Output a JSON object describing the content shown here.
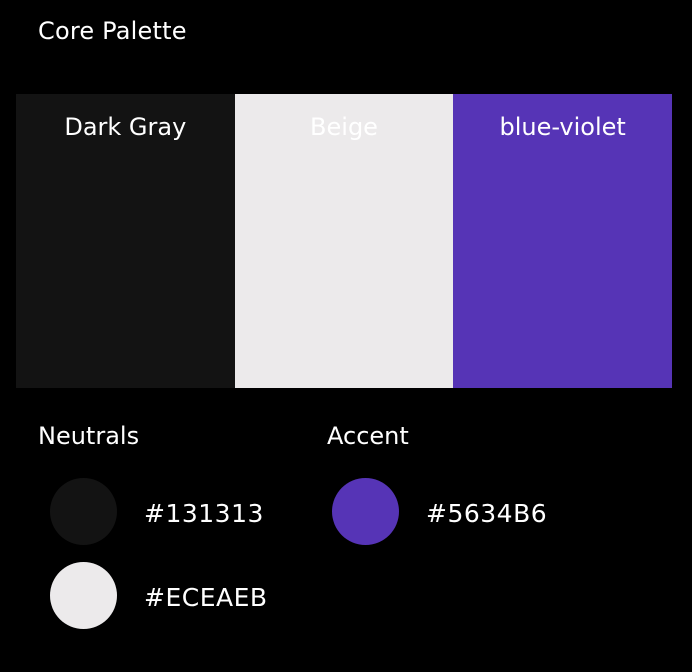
{
  "title": "Core Palette",
  "palette": [
    {
      "name": "Dark Gray",
      "color": "#131313"
    },
    {
      "name": "Beige",
      "color": "#ECEAEB"
    },
    {
      "name": "blue-violet",
      "color": "#5634B6"
    }
  ],
  "sections": {
    "neutrals": {
      "heading": "Neutrals",
      "items": [
        {
          "hex": "#131313",
          "color": "#131313"
        },
        {
          "hex": "#ECEAEB",
          "color": "#ECEAEB"
        }
      ]
    },
    "accent": {
      "heading": "Accent",
      "items": [
        {
          "hex": "#5634B6",
          "color": "#5634B6"
        }
      ]
    }
  },
  "colors": {
    "background": "#000000",
    "text": "#FFFFFF"
  }
}
